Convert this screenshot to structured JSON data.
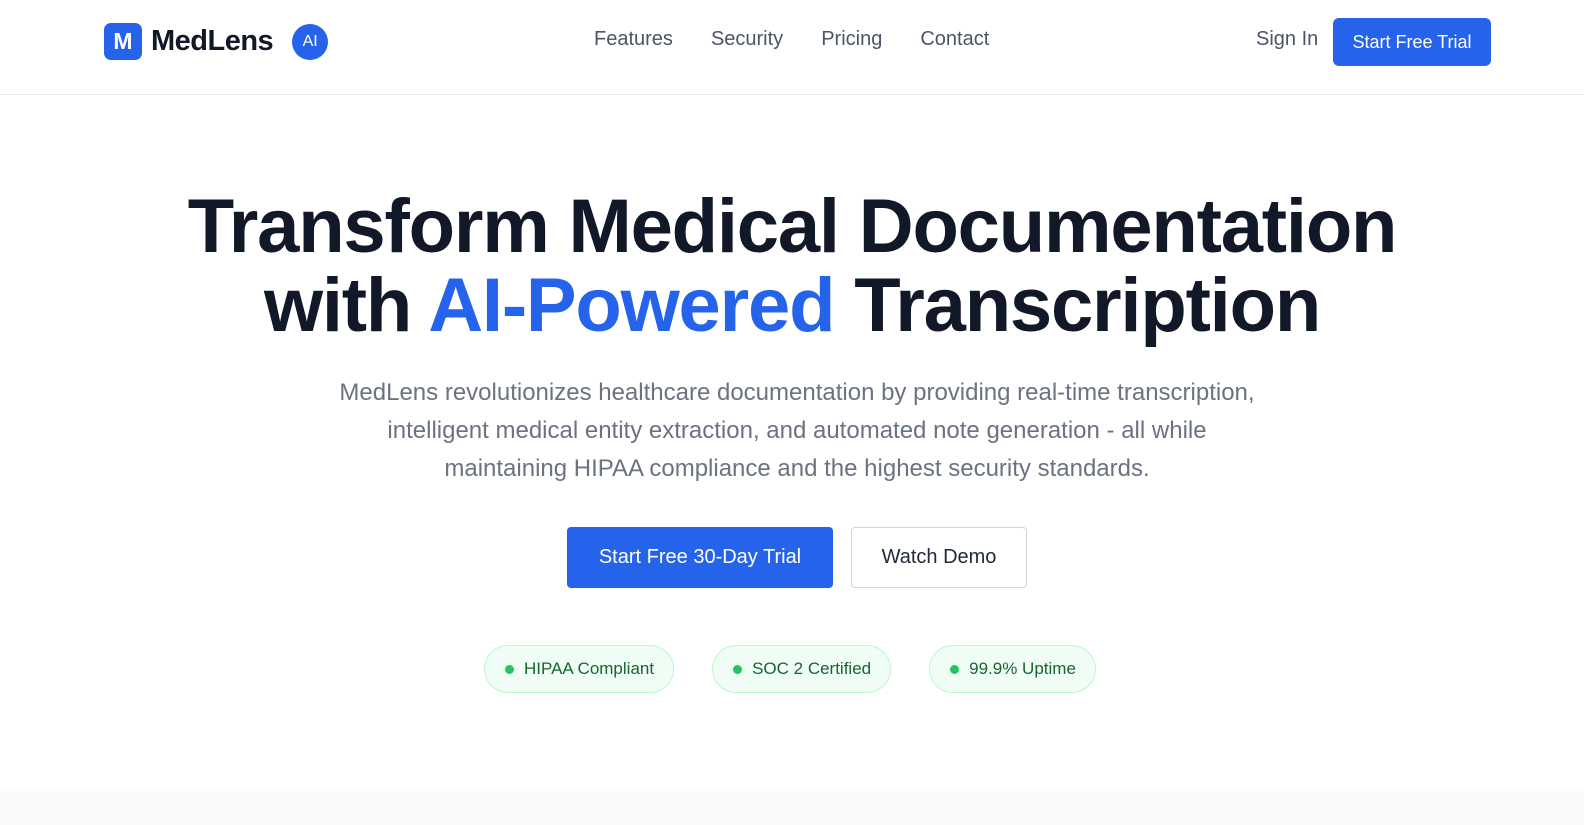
{
  "brand": {
    "logo_letter": "M",
    "name": "MedLens",
    "badge": "AI"
  },
  "nav": {
    "links": [
      "Features",
      "Security",
      "Pricing",
      "Contact"
    ],
    "sign_in": "Sign In",
    "cta": "Start Free Trial"
  },
  "hero": {
    "headline_line1": "Transform Medical Documentation",
    "headline_with": "with",
    "headline_accent": "AI-Powered",
    "headline_end": "Transcription",
    "subtext": "MedLens revolutionizes healthcare documentation by providing real-time transcription, intelligent medical entity extraction, and automated note generation - all while maintaining HIPAA compliance and the highest security standards.",
    "primary_cta": "Start Free 30-Day Trial",
    "secondary_cta": "Watch Demo"
  },
  "badges": [
    "HIPAA Compliant",
    "SOC 2 Certified",
    "99.9% Uptime"
  ],
  "colors": {
    "accent": "#2563eb",
    "heading": "#111827",
    "muted": "#6b7280",
    "badge_bg": "#f0fdf4",
    "badge_dot": "#22c55e",
    "badge_text": "#166534"
  }
}
